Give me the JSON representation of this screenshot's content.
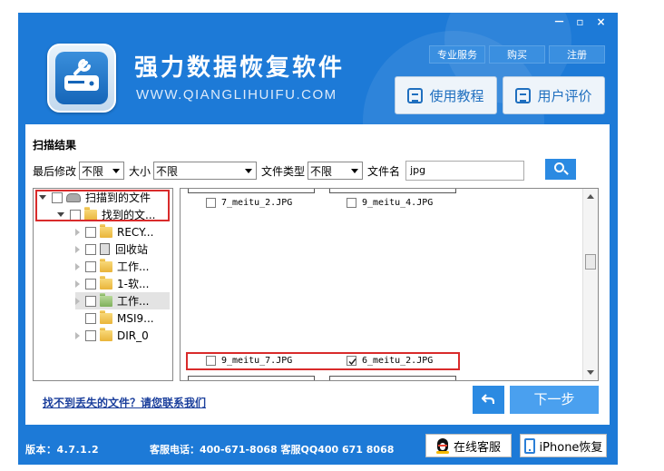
{
  "window": {
    "title": "强力数据恢复软件",
    "subtitle": "WWW.QIANGLIHUIFU.COM",
    "controls": [
      "－",
      "▫",
      "×"
    ]
  },
  "top_buttons": [
    "专业服务",
    "购买",
    "注册"
  ],
  "big_buttons": {
    "tutorial": "使用教程",
    "review": "用户评价"
  },
  "panel": {
    "title": "扫描结果"
  },
  "filters": {
    "modified_label": "最后修改",
    "modified_value": "不限",
    "size_label": "大小",
    "size_value": "不限",
    "type_label": "文件类型",
    "type_value": "不限",
    "name_label": "文件名",
    "name_value": "jpg"
  },
  "tree": [
    {
      "label": "扫描到的文件",
      "icon": "drive-icon"
    },
    {
      "label": "找到的文...",
      "icon": "folder-icon"
    },
    {
      "label": "RECY...",
      "icon": "folder-icon"
    },
    {
      "label": "回收站",
      "icon": "recycle-bin-icon"
    },
    {
      "label": "工作...",
      "icon": "folder-icon"
    },
    {
      "label": "1-软...",
      "icon": "folder-icon"
    },
    {
      "label": "工作...",
      "icon": "folder-icon"
    },
    {
      "label": "MSI9...",
      "icon": "folder-icon"
    },
    {
      "label": "DIR_0",
      "icon": "folder-icon"
    }
  ],
  "files": [
    {
      "name": "7_meitu_2.JPG",
      "checked": false
    },
    {
      "name": "9_meitu_4.JPG",
      "checked": false
    },
    {
      "name": "9_meitu_7.JPG",
      "checked": false
    },
    {
      "name": "6_meitu_2.JPG",
      "checked": true
    }
  ],
  "help_link": "找不到丢失的文件？请您联系我们",
  "next_button": "下一步",
  "footer": {
    "version": "版本：4.7.1.2",
    "phone": "客服电话：400-671-8068 客服QQ400 671 8068",
    "online_service": "在线客服",
    "iphone_recovery": "iPhone恢复"
  },
  "colors": {
    "frame_blue": "#1d7ad7",
    "highlight_red": "#d92b2b",
    "button_blue": "#2b8ae2"
  }
}
